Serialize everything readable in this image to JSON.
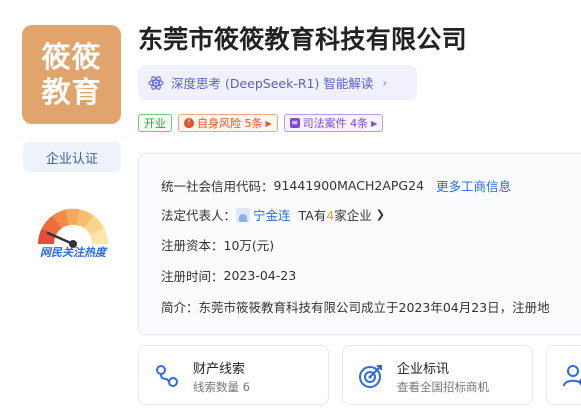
{
  "company": {
    "logo_lines": [
      "筱筱",
      "教育"
    ],
    "name": "东莞市筱筱教育科技有限公司",
    "certification": "企业认证",
    "heat_label": "网民关注热度"
  },
  "ai": {
    "label": "深度思考 (DeepSeek-R1) 智能解读",
    "chevron": "›"
  },
  "tags": {
    "status": "开业",
    "risk": "自身风险 5条",
    "law": "司法案件 4条"
  },
  "info": {
    "credit_code_label": "统一社会信用代码：",
    "credit_code": "91441900MACH2APG24",
    "more_link": "更多工商信息",
    "legal_rep_label": "法定代表人：",
    "legal_rep_name": "宁金连",
    "ta_prefix": "TA有",
    "ta_count": "4",
    "ta_suffix": "家企业",
    "capital_label": "注册资本：",
    "capital": "10万(元)",
    "reg_time_label": "注册时间：",
    "reg_time": "2023-04-23",
    "intro_label": "简介：",
    "intro": "东莞市筱筱教育科技有限公司成立于2023年04月23日，注册地"
  },
  "cards": [
    {
      "title": "财产线索",
      "sub": "线索数量 6",
      "icon": "property-clue-icon"
    },
    {
      "title": "企业标讯",
      "sub": "查看全国招标商机",
      "icon": "bid-target-icon"
    }
  ],
  "colors": {
    "logo_bg": "#E0A46C",
    "accent_blue": "#2F6BE0",
    "ai_purple": "#5A5FD0",
    "open_green": "#3E9B46",
    "risk_red": "#E2522B",
    "law_purple": "#7C4BD6",
    "count_orange": "#E8A317"
  }
}
